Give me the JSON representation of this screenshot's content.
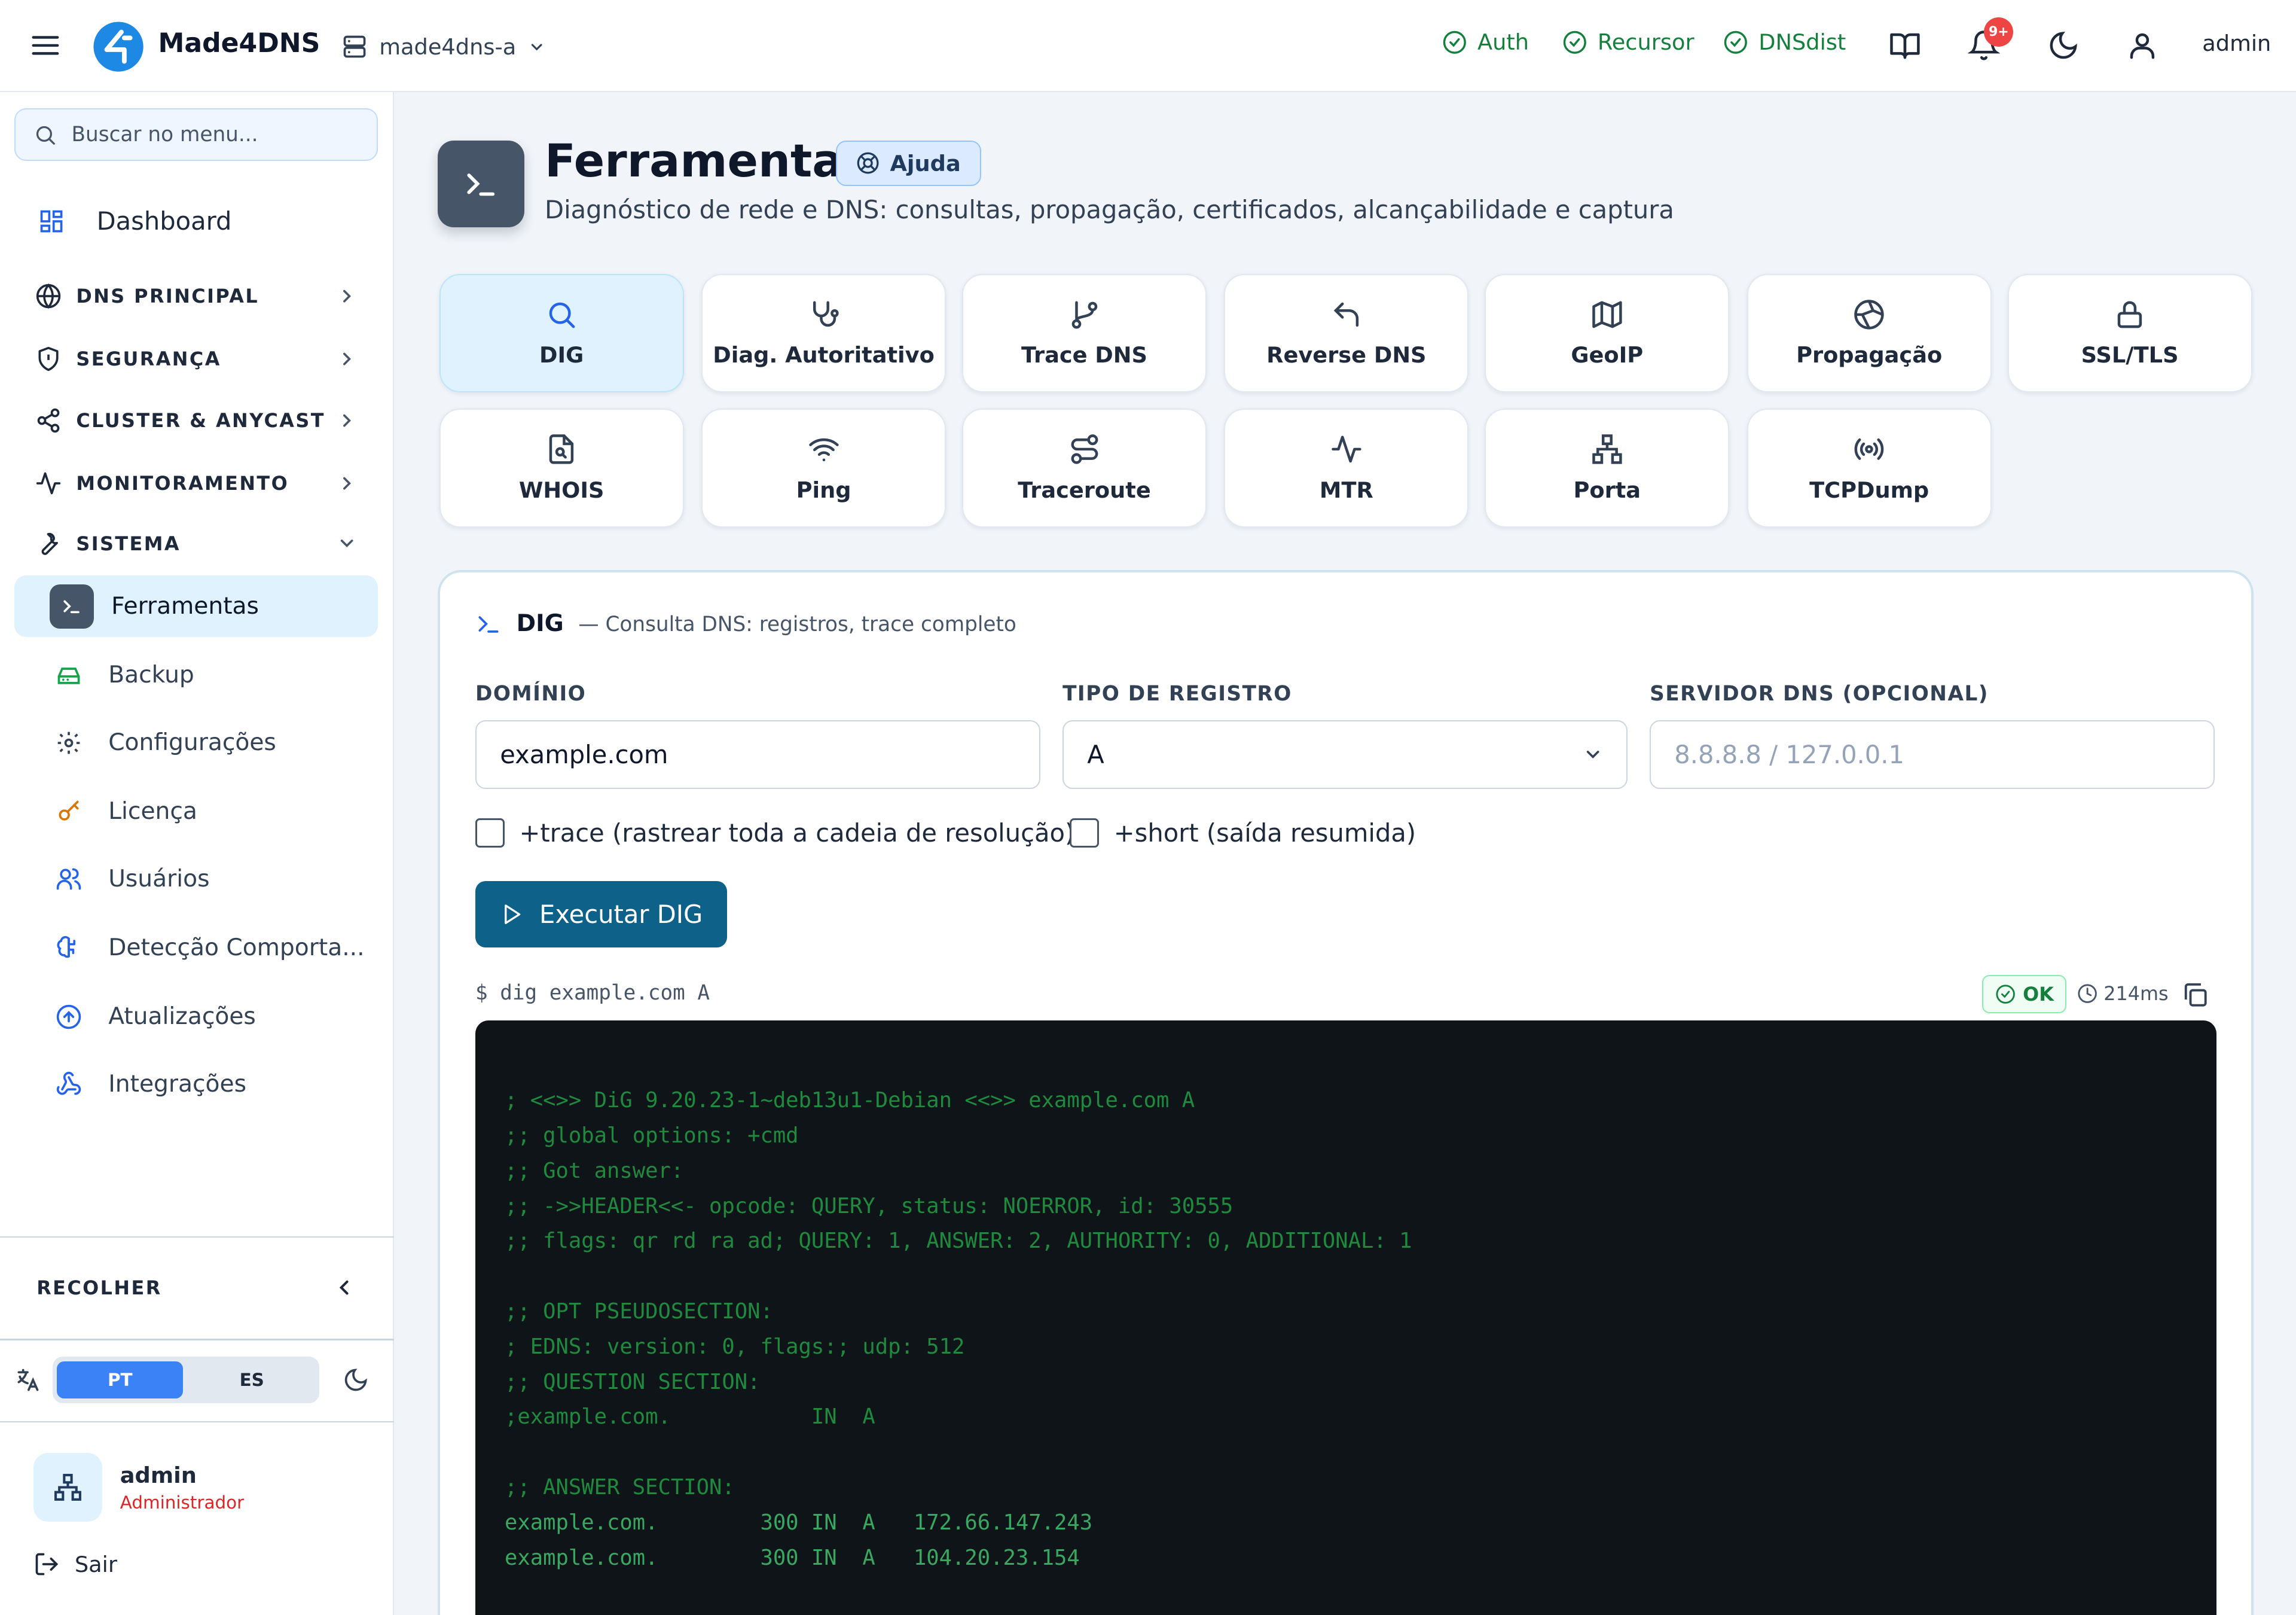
{
  "app": {
    "brand": "Made4DNS",
    "server_selector": "made4dns-a",
    "status": [
      {
        "label": "Auth",
        "color": "#15803d"
      },
      {
        "label": "Recursor",
        "color": "#15803d"
      },
      {
        "label": "DNSdist",
        "color": "#15803d"
      }
    ],
    "notifications_badge": "9+",
    "user": "admin"
  },
  "sidebar": {
    "search_placeholder": "Buscar no menu...",
    "dashboard": "Dashboard",
    "sections": [
      {
        "label": "DNS PRINCIPAL",
        "icon": "globe-icon"
      },
      {
        "label": "SEGURANÇA",
        "icon": "shield-icon"
      },
      {
        "label": "CLUSTER & ANYCAST",
        "icon": "share-icon"
      },
      {
        "label": "MONITORAMENTO",
        "icon": "activity-icon"
      },
      {
        "label": "SISTEMA",
        "icon": "wrench-icon"
      }
    ],
    "sistema_items": [
      {
        "label": "Ferramentas",
        "icon": "terminal-icon",
        "active": true
      },
      {
        "label": "Backup",
        "icon": "hard-drive-icon"
      },
      {
        "label": "Configurações",
        "icon": "gear-icon"
      },
      {
        "label": "Licença",
        "icon": "key-icon"
      },
      {
        "label": "Usuários",
        "icon": "users-icon"
      },
      {
        "label": "Detecção Comporta...",
        "icon": "brain-icon"
      },
      {
        "label": "Atualizações",
        "icon": "arrow-up-circle-icon"
      },
      {
        "label": "Integrações",
        "icon": "webhook-icon"
      }
    ],
    "collapse_label": "RECOLHER",
    "languages": [
      "PT",
      "ES"
    ],
    "active_language": "PT",
    "user_name": "admin",
    "user_role": "Administrador",
    "logout": "Sair"
  },
  "page": {
    "title": "Ferramentas",
    "help": "Ajuda",
    "subtitle": "Diagnóstico de rede e DNS: consultas, propagação, certificados, alcançabilidade e captura"
  },
  "tools": [
    {
      "label": "DIG",
      "icon": "search-icon",
      "active": true
    },
    {
      "label": "Diag. Autoritativo",
      "icon": "stethoscope-icon"
    },
    {
      "label": "Trace DNS",
      "icon": "git-branch-icon"
    },
    {
      "label": "Reverse DNS",
      "icon": "undo-arrow-icon"
    },
    {
      "label": "GeoIP",
      "icon": "map-icon"
    },
    {
      "label": "Propagação",
      "icon": "globe-network-icon"
    },
    {
      "label": "SSL/TLS",
      "icon": "lock-icon"
    },
    {
      "label": "WHOIS",
      "icon": "file-search-icon"
    },
    {
      "label": "Ping",
      "icon": "wifi-icon"
    },
    {
      "label": "Traceroute",
      "icon": "route-icon"
    },
    {
      "label": "MTR",
      "icon": "activity-icon"
    },
    {
      "label": "Porta",
      "icon": "network-icon"
    },
    {
      "label": "TCPDump",
      "icon": "radio-icon"
    }
  ],
  "panel": {
    "title": "DIG",
    "description": "— Consulta DNS: registros, trace completo",
    "domain_label": "DOMÍNIO",
    "domain_value": "example.com",
    "type_label": "TIPO DE REGISTRO",
    "type_value": "A",
    "server_label": "SERVIDOR DNS (OPCIONAL)",
    "server_placeholder": "8.8.8.8 / 127.0.0.1",
    "trace_label": "+trace (rastrear toda a cadeia de resolução)",
    "short_label": "+short (saída resumida)",
    "run_button": "Executar DIG",
    "command": "$ dig example.com A",
    "status": "OK",
    "elapsed": "214ms",
    "output_header": "; <<>> DiG 9.20.23-1~deb13u1-Debian <<>> example.com A\n;; global options: +cmd\n;; Got answer:\n;; ->>HEADER<<- opcode: QUERY, status: NOERROR, id: 30555\n;; flags: qr rd ra ad; QUERY: 1, ANSWER: 2, AUTHORITY: 0, ADDITIONAL: 1\n\n;; OPT PSEUDOSECTION:\n; EDNS: version: 0, flags:; udp: 512\n;; QUESTION SECTION:\n;example.com.           IN  A\n\n;; ANSWER SECTION:",
    "output_answers": "example.com.        300 IN  A   172.66.147.243\nexample.com.        300 IN  A   104.20.23.154"
  }
}
